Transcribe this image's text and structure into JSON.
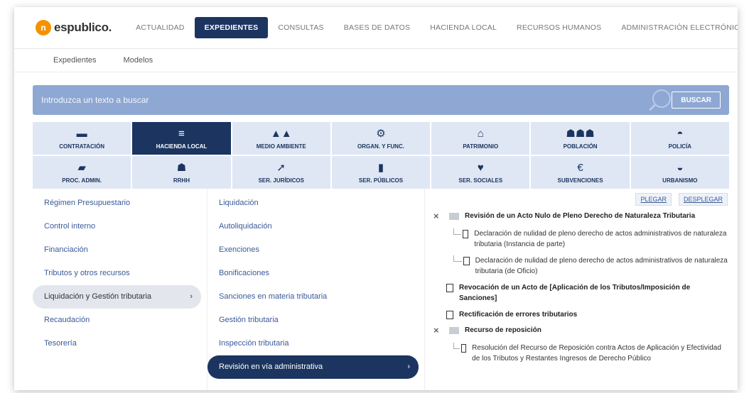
{
  "brand": {
    "logo_text": "espublico."
  },
  "nav": {
    "items": [
      "ACTUALIDAD",
      "EXPEDIENTES",
      "CONSULTAS",
      "BASES DE DATOS",
      "HACIENDA LOCAL",
      "RECURSOS HUMANOS",
      "ADMINISTRACIÓN ELECTRÓNICA"
    ],
    "active_index": 1
  },
  "subnav": {
    "items": [
      "Expedientes",
      "Modelos"
    ]
  },
  "search": {
    "placeholder": "Introduzca un texto a buscar",
    "button": "BUSCAR"
  },
  "categories": [
    {
      "label": "CONTRATACIÓN",
      "icon": "briefcase-icon"
    },
    {
      "label": "HACIENDA LOCAL",
      "icon": "coins-icon"
    },
    {
      "label": "MEDIO AMBIENTE",
      "icon": "trees-icon"
    },
    {
      "label": "ORGAN. Y FUNC.",
      "icon": "gears-icon"
    },
    {
      "label": "PATRIMONIO",
      "icon": "home-icon"
    },
    {
      "label": "POBLACIÓN",
      "icon": "people-icon"
    },
    {
      "label": "POLICÍA",
      "icon": "police-cap-icon"
    },
    {
      "label": "PROC. ADMIN.",
      "icon": "folder-icon"
    },
    {
      "label": "RRHH",
      "icon": "user-icon"
    },
    {
      "label": "SER. JURÍDICOS",
      "icon": "gavel-icon"
    },
    {
      "label": "SER. PÚBLICOS",
      "icon": "trash-icon"
    },
    {
      "label": "SER. SOCIALES",
      "icon": "heart-icon"
    },
    {
      "label": "SUBVENCIONES",
      "icon": "euro-icon"
    },
    {
      "label": "URBANISMO",
      "icon": "helmet-icon"
    }
  ],
  "selected_category": 1,
  "column1": {
    "items": [
      "Régimen Presupuestario",
      "Control interno",
      "Financiación",
      "Tributos y otros recursos",
      "Liquidación y Gestión tributaria",
      "Recaudación",
      "Tesorería"
    ],
    "selected_index": 4
  },
  "column2": {
    "items": [
      "Liquidación",
      "Autoliquidación",
      "Exenciones",
      "Bonificaciones",
      "Sanciones en materia tributaria",
      "Gestión tributaria",
      "Inspección tributaria",
      "Revisión en vía administrativa"
    ],
    "selected_index": 7
  },
  "tree": {
    "fold_label": "PLEGAR",
    "unfold_label": "DESPLEGAR",
    "nodes": {
      "n1": "Revisión de un Acto Nulo de Pleno Derecho de Naturaleza Tributaria",
      "n1c1": "Declaración de nulidad de pleno derecho de actos administrativos de naturaleza tributaria (Instancia de parte)",
      "n1c2": "Declaración de nulidad de pleno derecho de actos administrativos de naturaleza tributaria (de Oficio)",
      "n2": "Revocación de un Acto de [Aplicación de los Tributos/Imposición de Sanciones]",
      "n3": "Rectificación de errores tributarios",
      "n4": "Recurso de reposición",
      "n4c1": "Resolución del Recurso de Reposición contra Actos de Aplicación y Efectividad de los Tributos y Restantes Ingresos de Derecho Público"
    }
  }
}
